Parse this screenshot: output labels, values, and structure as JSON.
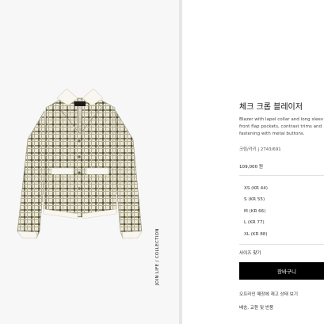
{
  "product": {
    "vertical_caption": "JOIN LIFE / COLLECTION",
    "title": "체크 크롭 블레이저",
    "description_lines": [
      "Blazer with lapel collar and long sleev",
      "front flap pockets, contrast trims and",
      "fastening with metal buttons."
    ],
    "color_code": "크림/카키 | 2743/691",
    "price": "109,000 원"
  },
  "sizes": [
    {
      "label": "XS (KR 44)"
    },
    {
      "label": "S (KR 55)"
    },
    {
      "label": "M (KR 66)"
    },
    {
      "label": "L (KR 77)"
    },
    {
      "label": "XL (KR 88)"
    }
  ],
  "size_guide": "사이즈 찾기",
  "cart_button": "장바구니",
  "stock_link": "오프라인 매장에 재고 상태 보기",
  "shipping_link": "배송, 교환 및 반품",
  "colors": {
    "accent": "#000000",
    "panel_bg": "#f7f7f7",
    "divider": "#e6e6e6"
  }
}
